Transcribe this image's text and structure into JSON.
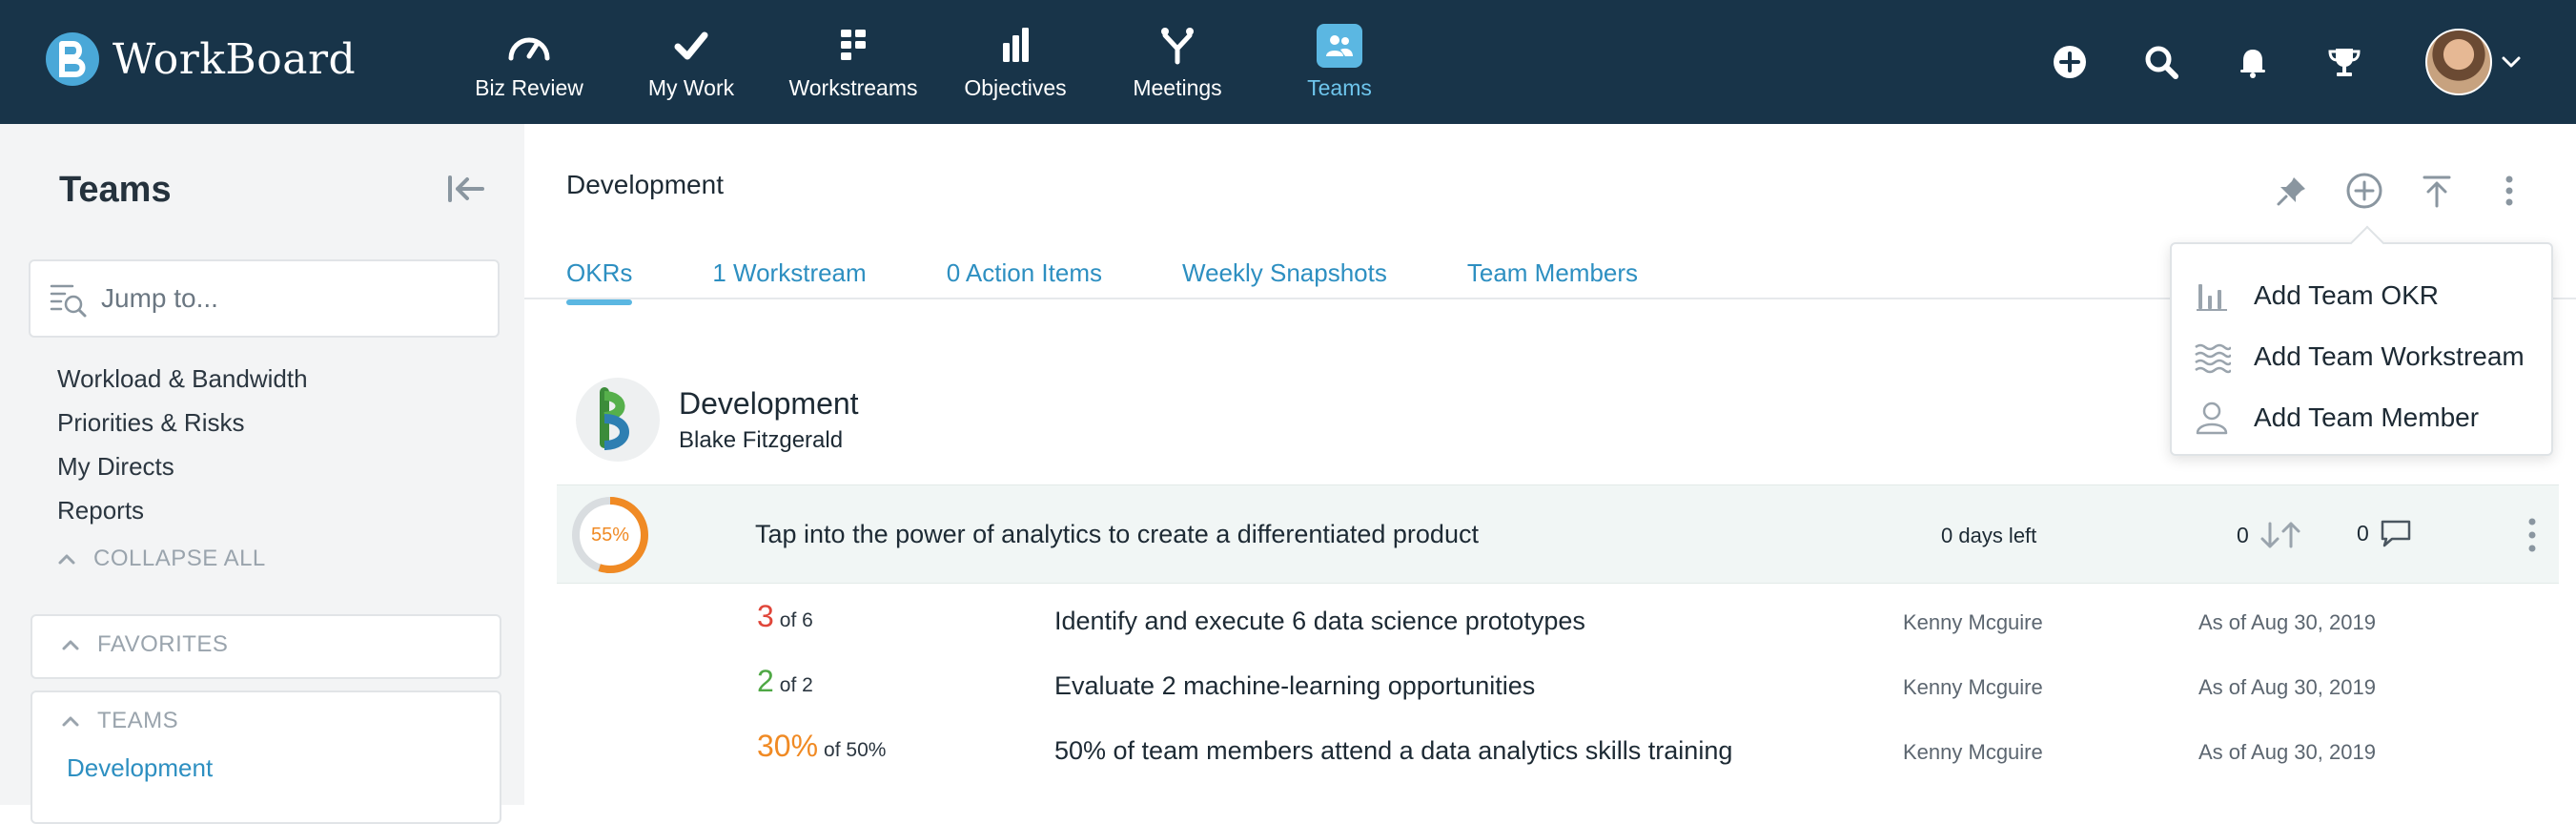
{
  "app": {
    "logo_text": "WorkBoard"
  },
  "nav": {
    "items": [
      {
        "label": "Biz Review",
        "icon": "gauge-icon"
      },
      {
        "label": "My Work",
        "icon": "check-icon"
      },
      {
        "label": "Workstreams",
        "icon": "workstreams-icon"
      },
      {
        "label": "Objectives",
        "icon": "bar-chart-icon"
      },
      {
        "label": "Meetings",
        "icon": "meetings-icon"
      },
      {
        "label": "Teams",
        "icon": "teams-icon"
      }
    ],
    "active": "Teams"
  },
  "sidebar": {
    "title": "Teams",
    "search_placeholder": "Jump to...",
    "links": [
      "Workload & Bandwidth",
      "Priorities & Risks",
      "My Directs",
      "Reports"
    ],
    "collapse_all": "COLLAPSE ALL",
    "favorites_label": "FAVORITES",
    "teams_label": "TEAMS",
    "teams": [
      "Development"
    ]
  },
  "main": {
    "team_name": "Development",
    "tabs": [
      "OKRs",
      "1 Workstream",
      "0 Action Items",
      "Weekly Snapshots",
      "Team Members"
    ],
    "active_tab": "OKRs",
    "team_card": {
      "title": "Development",
      "owner": "Blake Fitzgerald"
    },
    "objective": {
      "progress_label": "55%",
      "progress": 0.55,
      "title": "Tap into the power of analytics to create a differentiated product",
      "days_left": "0 days left",
      "votes": "0",
      "comments": "0"
    },
    "key_results": [
      {
        "value": "3",
        "of": "of 6",
        "color": "#e0463a",
        "title": "Identify and execute 6 data science prototypes",
        "owner": "Kenny Mcguire",
        "date": "As of Aug 30, 2019"
      },
      {
        "value": "2",
        "of": "of 2",
        "color": "#4fa845",
        "title": "Evaluate 2 machine-learning opportunities",
        "owner": "Kenny Mcguire",
        "date": "As of Aug 30, 2019"
      },
      {
        "value": "30%",
        "of": "of 50%",
        "color": "#f08a24",
        "title": "50% of team members attend a data analytics skills training",
        "owner": "Kenny Mcguire",
        "date": "As of Aug 30, 2019"
      }
    ]
  },
  "dropdown": {
    "items": [
      {
        "label": "Add Team OKR",
        "icon": "okr-bars-icon"
      },
      {
        "label": "Add Team Workstream",
        "icon": "workstream-waves-icon"
      },
      {
        "label": "Add Team Member",
        "icon": "person-icon"
      }
    ]
  },
  "colors": {
    "header_bg": "#183449",
    "accent": "#5bb7e2",
    "link": "#2d8fc1"
  }
}
